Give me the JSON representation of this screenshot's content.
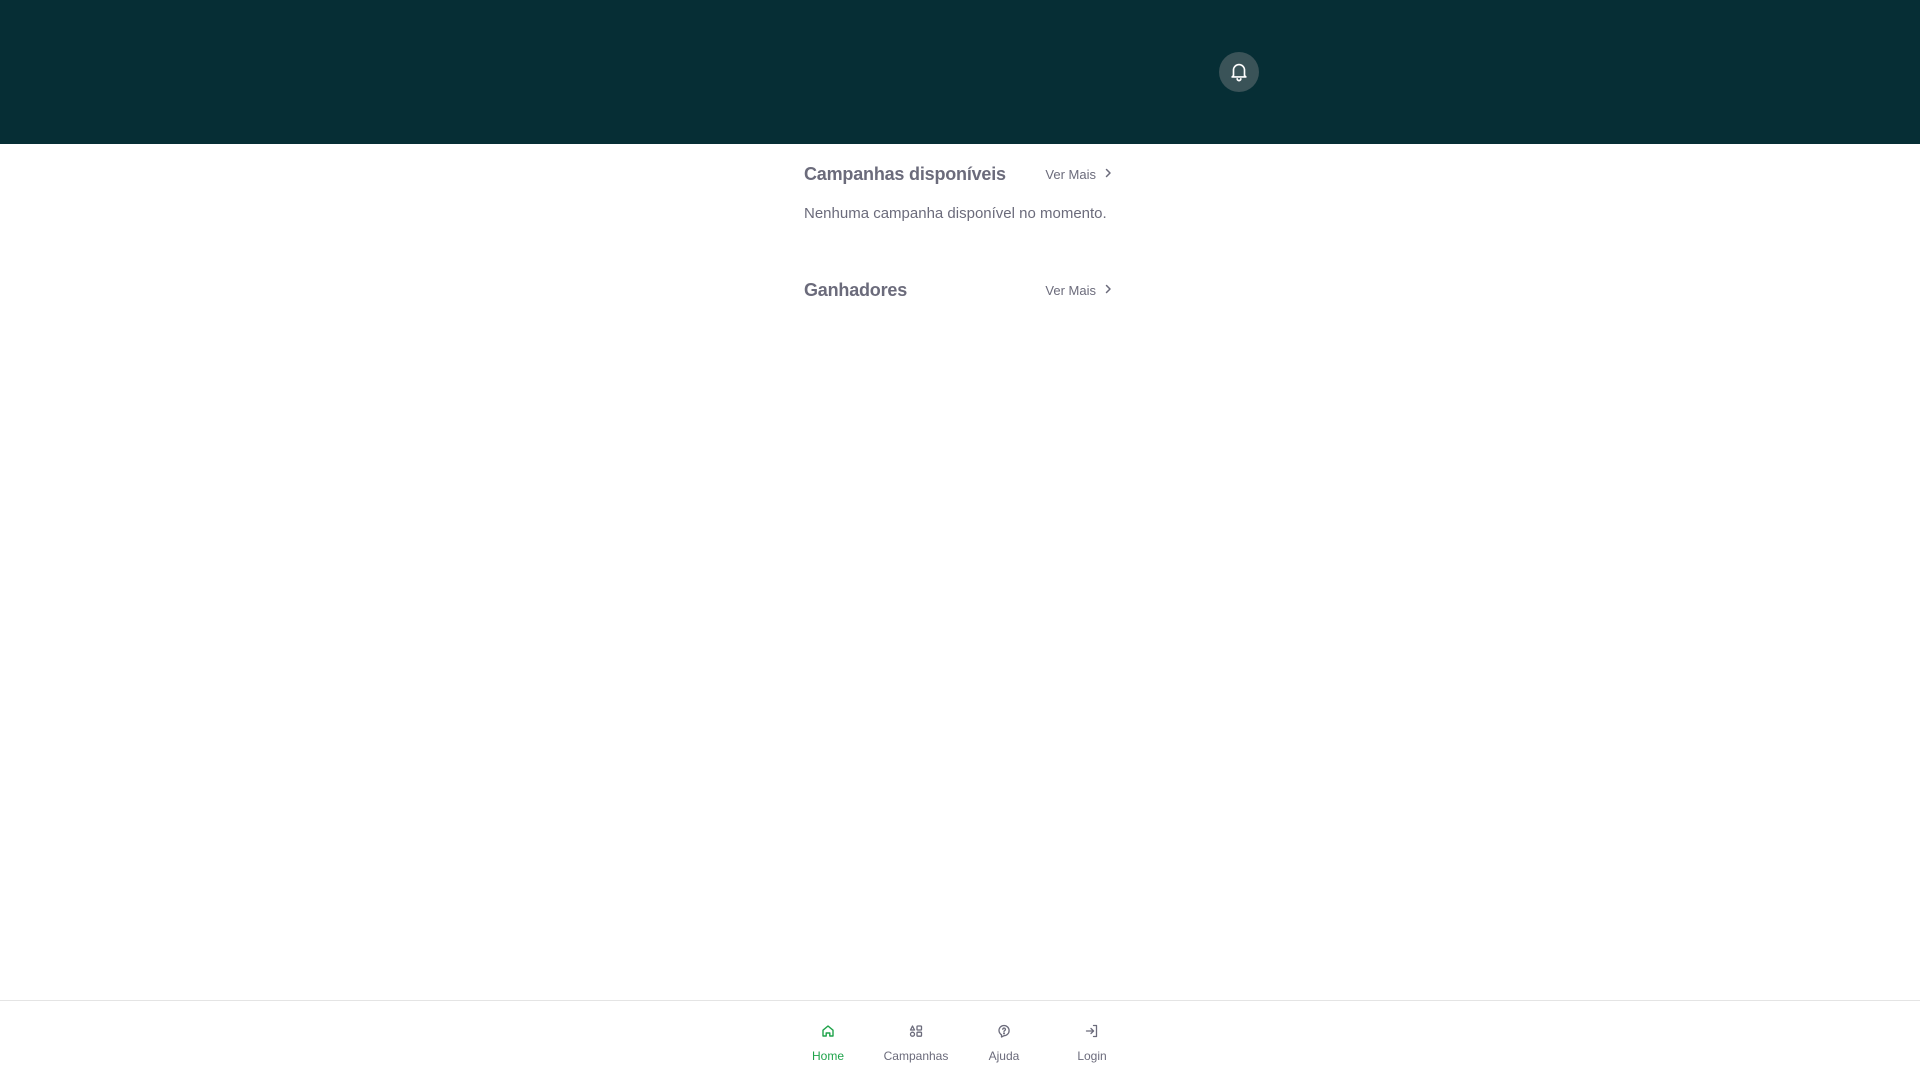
{
  "colors": {
    "header_bg": "#062e35",
    "bell_bg": "#3a5358",
    "text_muted": "#6b6b7b",
    "active_green": "#1fa34a",
    "divider": "#e4e4e4"
  },
  "header": {
    "notification_icon": "bell-icon"
  },
  "sections": {
    "campaigns": {
      "title": "Campanhas disponíveis",
      "see_more": "Ver Mais",
      "empty_message": "Nenhuma campanha disponível no momento."
    },
    "winners": {
      "title": "Ganhadores",
      "see_more": "Ver Mais"
    }
  },
  "bottom_nav": {
    "items": [
      {
        "label": "Home",
        "icon": "home-icon",
        "active": true
      },
      {
        "label": "Campanhas",
        "icon": "campaigns-icon",
        "active": false
      },
      {
        "label": "Ajuda",
        "icon": "help-icon",
        "active": false
      },
      {
        "label": "Login",
        "icon": "login-icon",
        "active": false
      }
    ]
  }
}
